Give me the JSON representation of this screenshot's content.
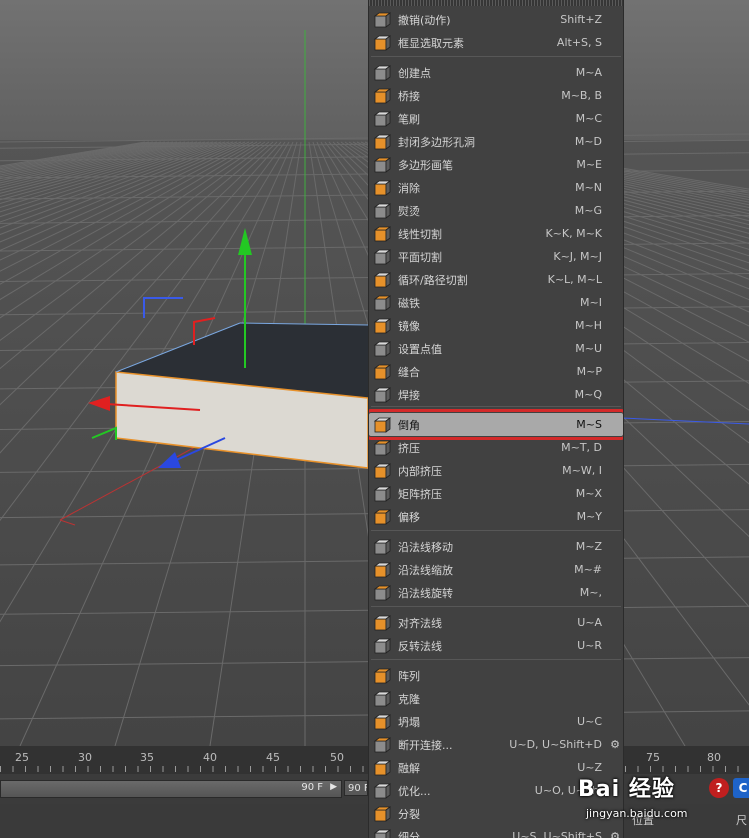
{
  "menu": {
    "items": [
      {
        "label": "撤销(动作)",
        "shortcut": "Shift+Z",
        "icon": "undo-icon"
      },
      {
        "label": "框显选取元素",
        "shortcut": "Alt+S, S",
        "icon": "frame-selection-icon"
      },
      {
        "label": "创建点",
        "shortcut": "M~A",
        "icon": "create-point-icon"
      },
      {
        "label": "桥接",
        "shortcut": "M~B, B",
        "icon": "bridge-icon"
      },
      {
        "label": "笔刷",
        "shortcut": "M~C",
        "icon": "brush-icon"
      },
      {
        "label": "封闭多边形孔洞",
        "shortcut": "M~D",
        "icon": "close-hole-icon"
      },
      {
        "label": "多边形画笔",
        "shortcut": "M~E",
        "icon": "polygon-pen-icon"
      },
      {
        "label": "消除",
        "shortcut": "M~N",
        "icon": "dissolve-icon"
      },
      {
        "label": "熨烫",
        "shortcut": "M~G",
        "icon": "iron-icon"
      },
      {
        "label": "线性切割",
        "shortcut": "K~K, M~K",
        "icon": "knife-icon"
      },
      {
        "label": "平面切割",
        "shortcut": "K~J, M~J",
        "icon": "plane-cut-icon"
      },
      {
        "label": "循环/路径切割",
        "shortcut": "K~L, M~L",
        "icon": "loop-cut-icon"
      },
      {
        "label": "磁铁",
        "shortcut": "M~I",
        "icon": "magnet-icon"
      },
      {
        "label": "镜像",
        "shortcut": "M~H",
        "icon": "mirror-icon"
      },
      {
        "label": "设置点值",
        "shortcut": "M~U",
        "icon": "set-point-value-icon"
      },
      {
        "label": "缝合",
        "shortcut": "M~P",
        "icon": "stitch-icon"
      },
      {
        "label": "焊接",
        "shortcut": "M~Q",
        "icon": "weld-icon"
      },
      {
        "label": "倒角",
        "shortcut": "M~S",
        "icon": "bevel-icon"
      },
      {
        "label": "挤压",
        "shortcut": "M~T, D",
        "icon": "extrude-icon"
      },
      {
        "label": "内部挤压",
        "shortcut": "M~W, I",
        "icon": "extrude-inner-icon"
      },
      {
        "label": "矩阵挤压",
        "shortcut": "M~X",
        "icon": "matrix-extrude-icon"
      },
      {
        "label": "偏移",
        "shortcut": "M~Y",
        "icon": "offset-icon"
      },
      {
        "label": "沿法线移动",
        "shortcut": "M~Z",
        "icon": "normal-move-icon"
      },
      {
        "label": "沿法线缩放",
        "shortcut": "M~#",
        "icon": "normal-scale-icon"
      },
      {
        "label": "沿法线旋转",
        "shortcut": "M~,",
        "icon": "normal-rotate-icon"
      },
      {
        "label": "对齐法线",
        "shortcut": "U~A",
        "icon": "align-normals-icon"
      },
      {
        "label": "反转法线",
        "shortcut": "U~R",
        "icon": "reverse-normals-icon"
      },
      {
        "label": "阵列",
        "shortcut": "",
        "icon": "array-icon"
      },
      {
        "label": "克隆",
        "shortcut": "",
        "icon": "clone-icon"
      },
      {
        "label": "坍塌",
        "shortcut": "U~C",
        "icon": "collapse-icon"
      },
      {
        "label": "断开连接...",
        "shortcut": "U~D, U~Shift+D",
        "icon": "disconnect-icon"
      },
      {
        "label": "融解",
        "shortcut": "U~Z",
        "icon": "melt-icon"
      },
      {
        "label": "优化...",
        "shortcut": "U~O, U~Shi",
        "icon": "optimize-icon"
      },
      {
        "label": "分裂",
        "shortcut": "",
        "icon": "split-icon"
      },
      {
        "label": "细分",
        "shortcut": "U~S, U~Shift+S",
        "icon": "subdivide-icon"
      }
    ]
  },
  "timeline": {
    "ruler_left": [
      "25",
      "30",
      "35",
      "40",
      "45",
      "50"
    ],
    "ruler_right": [
      "75",
      "80"
    ],
    "end_frame_1": "90 F",
    "end_frame_2": "90 F"
  },
  "bottom_labels": {
    "position": "位置",
    "size": "尺"
  },
  "watermark": {
    "logo": "Bai 经验",
    "url": "jingyan.baidu.com"
  },
  "colors": {
    "menu_bg": "#414141",
    "selected_bg": "#a9a9a9",
    "highlight_box": "#d42a2a",
    "axis_x": "#e02020",
    "axis_y": "#23c823",
    "axis_z": "#2a48e0"
  }
}
